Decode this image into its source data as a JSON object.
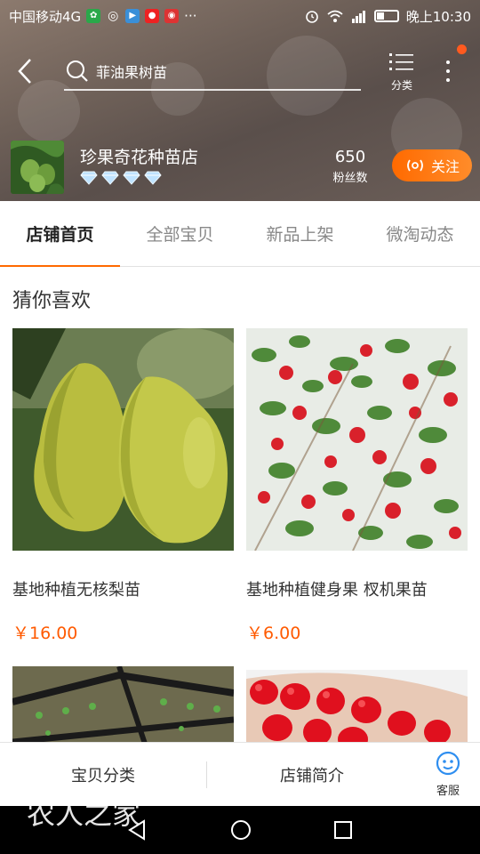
{
  "status_bar": {
    "carrier": "中国移动4G",
    "more": "···",
    "time": "晚上10:30"
  },
  "search": {
    "query": "菲油果树苗"
  },
  "header": {
    "category_label": "分类"
  },
  "shop": {
    "name": "珍果奇花种苗店",
    "diamond_count": 4,
    "fans_count": "650",
    "fans_label": "粉丝数",
    "follow_label": "关注"
  },
  "tabs": [
    {
      "label": "店铺首页",
      "active": true
    },
    {
      "label": "全部宝贝",
      "active": false
    },
    {
      "label": "新品上架",
      "active": false
    },
    {
      "label": "微淘动态",
      "active": false
    }
  ],
  "recommend": {
    "title": "猜你喜欢",
    "products": [
      {
        "title": "基地种植无核梨苗",
        "price": "￥16.00",
        "image": "pear"
      },
      {
        "title": "基地种植健身果 杈机果苗",
        "price": "￥6.00",
        "image": "red-berry-shrub"
      },
      {
        "title": "",
        "price": "",
        "image": "seedling-trays"
      },
      {
        "title": "",
        "price": "",
        "image": "pomegranate-seeds"
      }
    ]
  },
  "bottom_bar": {
    "category": "宝贝分类",
    "intro": "店铺简介",
    "service": "客服"
  },
  "watermark": "农人之家",
  "colors": {
    "accent": "#ff6a00",
    "price": "#ff5a00"
  }
}
